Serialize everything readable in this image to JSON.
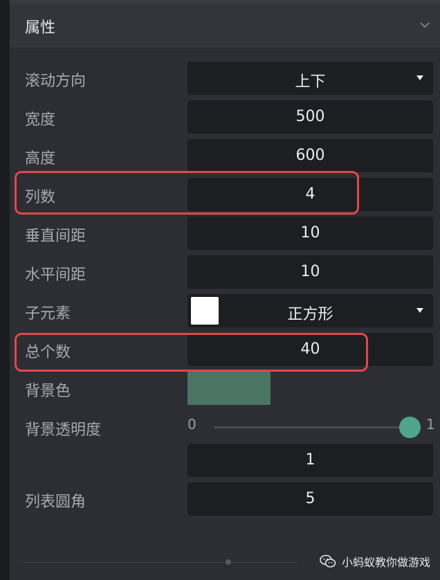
{
  "panel": {
    "title": "属性"
  },
  "rows": [
    {
      "label": "滚动方向",
      "value": "上下"
    },
    {
      "label": "宽度",
      "value": "500"
    },
    {
      "label": "高度",
      "value": "600"
    },
    {
      "label": "列数",
      "value": "4"
    },
    {
      "label": "垂直间距",
      "value": "10"
    },
    {
      "label": "水平间距",
      "value": "10"
    },
    {
      "label": "子元素",
      "value": "正方形"
    },
    {
      "label": "总个数",
      "value": "40"
    },
    {
      "label": "背景色"
    },
    {
      "label": "背景透明度",
      "slider_min": "0",
      "slider_max": "1",
      "slider_level": 1,
      "value": "1"
    },
    {
      "label": "列表圆角",
      "value": "5"
    }
  ],
  "colors": {
    "background_color_swatch": "#4a7565",
    "child_element_swatch": "#ffffff",
    "highlight": "#e04848",
    "slider_thumb": "#4fa58a"
  },
  "watermark": {
    "text": "小蚂蚁教你做游戏",
    "icon": "wechat-icon"
  }
}
